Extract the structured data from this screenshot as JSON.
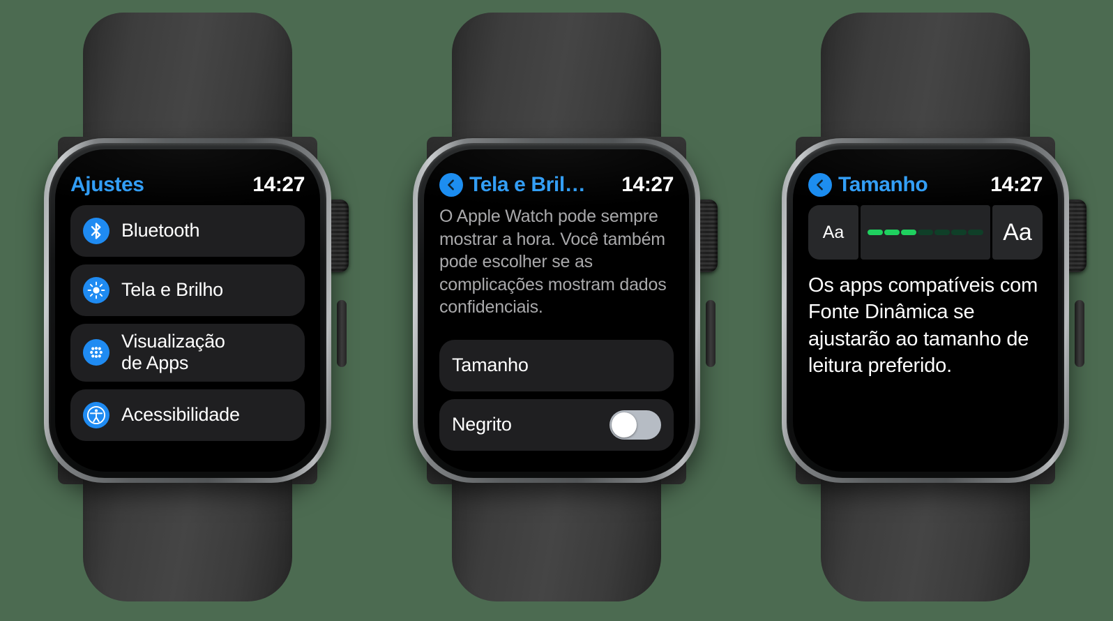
{
  "theme": {
    "background": "#4c6b51",
    "accent_blue": "#2f9cf5",
    "icon_blue": "#1f8bf2",
    "slider_green": "#1fd05f",
    "slider_green_dim": "#0f3f28",
    "row_bg": "#1f1f21",
    "screen_bg": "#000000"
  },
  "watches": [
    {
      "id": "watch-settings",
      "status": {
        "title": "Ajustes",
        "time": "14:27",
        "has_back": false
      },
      "rows": [
        {
          "icon": "bluetooth-icon",
          "label": "Bluetooth"
        },
        {
          "icon": "brightness-icon",
          "label": "Tela e Brilho"
        },
        {
          "icon": "app-grid-icon",
          "label": "Visualização\nde Apps"
        },
        {
          "icon": "accessibility-icon",
          "label": "Acessibilidade"
        }
      ]
    },
    {
      "id": "watch-display-brightness",
      "status": {
        "title": "Tela e Bril…",
        "time": "14:27",
        "has_back": true
      },
      "paragraph": "O Apple Watch pode sempre mostrar a hora. Você também pode escolher se as complicações mostram dados confidenciais.",
      "rows": [
        {
          "label": "Tamanho",
          "control": "none"
        },
        {
          "label": "Negrito",
          "control": "toggle",
          "toggle_on": false
        }
      ]
    },
    {
      "id": "watch-text-size",
      "status": {
        "title": "Tamanho",
        "time": "14:27",
        "has_back": true
      },
      "size_control": {
        "decrease_label": "Aa",
        "increase_label": "Aa",
        "steps_total": 7,
        "steps_filled": 3
      },
      "paragraph": "Os apps compatíveis com Fonte Dinâmica se ajustarão ao tamanho de leitura preferido."
    }
  ]
}
